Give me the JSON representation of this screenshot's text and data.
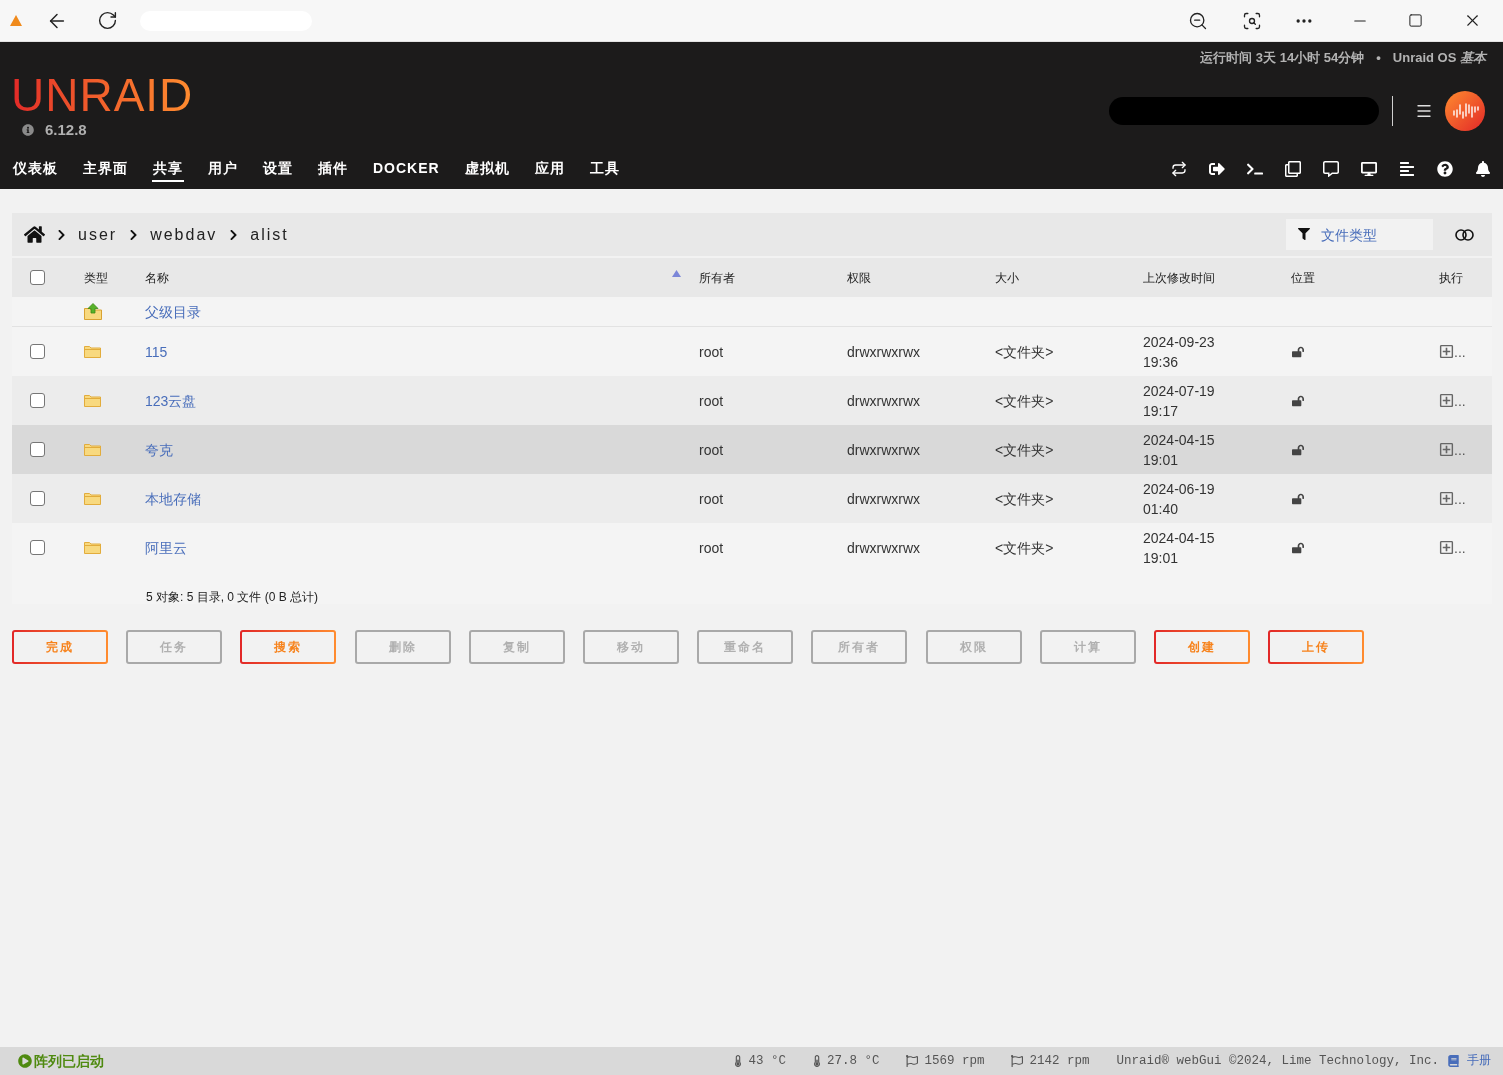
{
  "header": {
    "uptime": "运行时间 3天 14小时 54分钟",
    "separator": "•",
    "os": "Unraid OS *基本*",
    "logo": "UNRAID",
    "version": "6.12.8"
  },
  "nav": {
    "tabs": [
      {
        "label": "仪表板",
        "selected": false
      },
      {
        "label": "主界面",
        "selected": false
      },
      {
        "label": "共享",
        "selected": true
      },
      {
        "label": "用户",
        "selected": false
      },
      {
        "label": "设置",
        "selected": false
      },
      {
        "label": "插件",
        "selected": false
      },
      {
        "label": "DOCKER",
        "selected": false
      },
      {
        "label": "虚拟机",
        "selected": false
      },
      {
        "label": "应用",
        "selected": false
      },
      {
        "label": "工具",
        "selected": false
      }
    ]
  },
  "breadcrumb": [
    {
      "label": "user"
    },
    {
      "label": "webdav"
    },
    {
      "label": "alist"
    }
  ],
  "filter": {
    "placeholder": "文件类型"
  },
  "table": {
    "select_all": {
      "checked": false
    },
    "columns": [
      {
        "label": "类型",
        "sorted": false
      },
      {
        "label": "名称",
        "sorted": true
      },
      {
        "label": "所有者",
        "sorted": false
      },
      {
        "label": "权限",
        "sorted": false
      },
      {
        "label": "大小",
        "sorted": false
      },
      {
        "label": "上次修改时间",
        "sorted": false
      },
      {
        "label": "位置",
        "sorted": false
      },
      {
        "label": "执行",
        "sorted": false
      }
    ],
    "parent_row": {
      "name": "父级目录"
    },
    "rows": [
      {
        "checked": false,
        "highlighted": false,
        "name": "115",
        "owner": "root",
        "permissions": "drwxrwxrwx",
        "size": "<文件夹>",
        "modified": "2024-09-23 19:36",
        "more": "..."
      },
      {
        "checked": false,
        "highlighted": false,
        "name": "123云盘",
        "owner": "root",
        "permissions": "drwxrwxrwx",
        "size": "<文件夹>",
        "modified": "2024-07-19 19:17",
        "more": "..."
      },
      {
        "checked": false,
        "highlighted": true,
        "name": "夸克",
        "owner": "root",
        "permissions": "drwxrwxrwx",
        "size": "<文件夹>",
        "modified": "2024-04-15 19:01",
        "more": "..."
      },
      {
        "checked": false,
        "highlighted": false,
        "name": "本地存储",
        "owner": "root",
        "permissions": "drwxrwxrwx",
        "size": "<文件夹>",
        "modified": "2024-06-19 01:40",
        "more": "..."
      },
      {
        "checked": false,
        "highlighted": false,
        "name": "阿里云",
        "owner": "root",
        "permissions": "drwxrwxrwx",
        "size": "<文件夹>",
        "modified": "2024-04-15 19:01",
        "more": "..."
      }
    ],
    "summary": "5 对象: 5 目录, 0 文件 (0 B 总计)"
  },
  "buttons": [
    {
      "label": "完成",
      "disabled": false
    },
    {
      "label": "任务",
      "disabled": true
    },
    {
      "label": "搜索",
      "disabled": false
    },
    {
      "label": "删除",
      "disabled": true
    },
    {
      "label": "复制",
      "disabled": true
    },
    {
      "label": "移动",
      "disabled": true
    },
    {
      "label": "重命名",
      "disabled": true
    },
    {
      "label": "所有者",
      "disabled": true
    },
    {
      "label": "权限",
      "disabled": true
    },
    {
      "label": "计算",
      "disabled": true
    },
    {
      "label": "创建",
      "disabled": false
    },
    {
      "label": "上传",
      "disabled": false
    }
  ],
  "status_bar": {
    "array_status": "阵列已启动",
    "sensors": [
      {
        "kind": "temperature",
        "reading": "43 °C"
      },
      {
        "kind": "temperature",
        "reading": "27.8 °C"
      },
      {
        "kind": "fan",
        "reading": "1569 rpm"
      },
      {
        "kind": "fan",
        "reading": "2142 rpm"
      }
    ],
    "copyright": "Unraid® webGui ©2024, Lime Technology, Inc.",
    "manual": "手册"
  }
}
